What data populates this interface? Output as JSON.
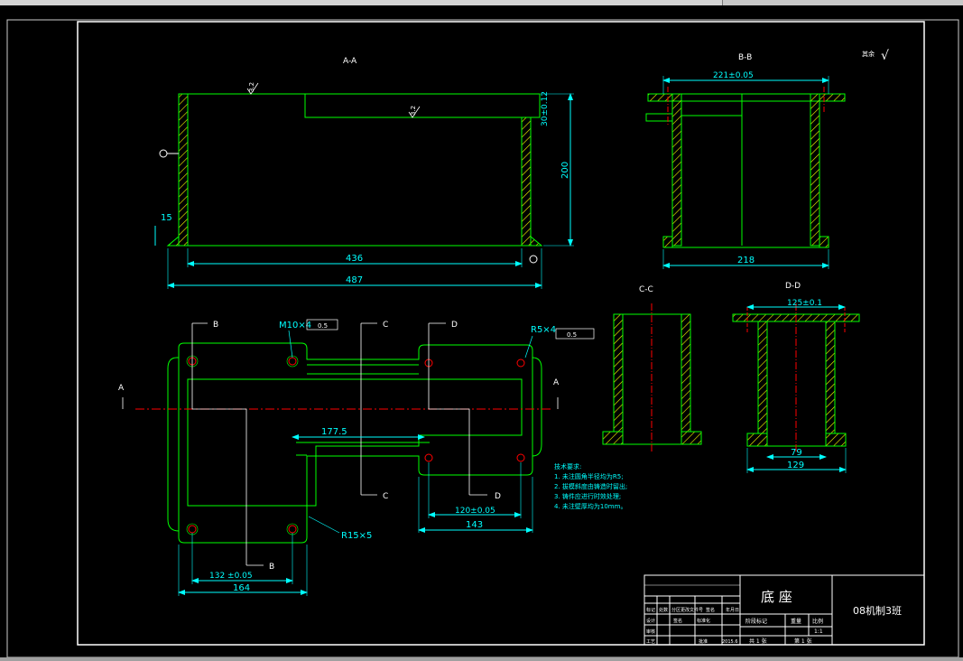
{
  "views": {
    "aa": {
      "title": "A-A",
      "dims": {
        "d436": "436",
        "d487": "487",
        "d200": "200",
        "d15": "15",
        "d30": "30±0.12",
        "s1": "3.2",
        "s2": "3.2"
      }
    },
    "bb": {
      "title": "B-B",
      "dims": {
        "d221": "221±0.05",
        "d218": "218"
      }
    },
    "cc": {
      "title": "C-C"
    },
    "dd": {
      "title": "D-D",
      "dims": {
        "d125": "125±0.1",
        "d79": "79",
        "d129": "129"
      }
    },
    "plan": {
      "cut_a": "A",
      "cut_b": "B",
      "cut_c": "C",
      "cut_d": "D",
      "m10": "M10×4",
      "r5": "R5×4",
      "r15": "R15×5",
      "tol_m10": "0.5",
      "tol_r5": "0.5",
      "d1775": "177.5",
      "d120": "120±0.05",
      "d143": "143",
      "d132": "132 ±0.05",
      "d164": "164"
    }
  },
  "surface_mark": {
    "label": "其余",
    "symbol": "√"
  },
  "notes": {
    "title": "技术要求:",
    "lines": [
      "1. 未注圆角半径均为R5;",
      "2. 拔模斜度由铸造时留出;",
      "3. 铸件应进行时效处理;",
      "4. 未注壁厚均为10mm。"
    ]
  },
  "title_block": {
    "part_name": "底 座",
    "class_name": "08机制3班",
    "scale": "1:1",
    "sheet_total": "共 1 张",
    "sheet_no": "第 1 张",
    "date": "2015.6",
    "hdr": [
      "标记",
      "处数",
      "分区",
      "更改文件号",
      "签名",
      "年月日"
    ],
    "r2": [
      "设计",
      "签名",
      "标准化"
    ],
    "r3": [
      "审核"
    ],
    "r4": [
      "工艺",
      "批准"
    ],
    "mid_hdr": [
      "阶段标记",
      "重量",
      "比例"
    ]
  },
  "colors": {
    "outline": "#00ff00",
    "dim": "#00ffff",
    "center": "#ff0000",
    "hatch": "#ffff00",
    "text": "#ffffff",
    "frame": "#ffffff"
  }
}
